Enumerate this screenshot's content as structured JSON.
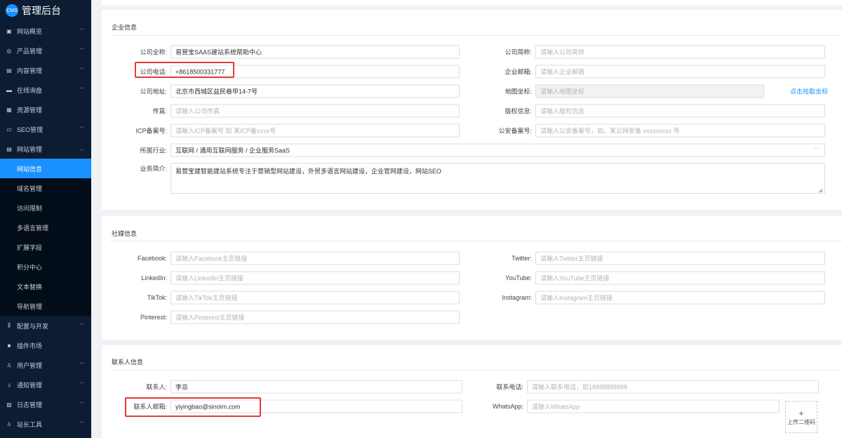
{
  "app": {
    "logo_badge": "CMS",
    "title": "管理后台"
  },
  "sidebar": {
    "items": [
      {
        "label": "网站概览",
        "icon": "monitor-icon",
        "ic": "▣",
        "chev": true
      },
      {
        "label": "产品管理",
        "icon": "cube-icon",
        "ic": "◎",
        "chev": true
      },
      {
        "label": "内容管理",
        "icon": "document-icon",
        "ic": "▤",
        "chev": true
      },
      {
        "label": "在线询盘",
        "icon": "chat-icon",
        "ic": "▬",
        "chev": true
      },
      {
        "label": "资源管理",
        "icon": "folder-icon",
        "ic": "▦",
        "chev": false
      },
      {
        "label": "SEO管理",
        "icon": "seo-icon",
        "ic": "▭",
        "chev": true
      },
      {
        "label": "网站管理",
        "icon": "site-icon",
        "ic": "▤",
        "chev": "up"
      }
    ],
    "subitems": [
      "网站信息",
      "域名管理",
      "访问限制",
      "多语言管理",
      "扩展字段",
      "积分中心",
      "文本替换",
      "导航管理"
    ],
    "active_sub": 0,
    "items2": [
      {
        "label": "配置与开发",
        "icon": "sliders-icon",
        "ic": "⫼",
        "chev": true
      },
      {
        "label": "插件市场",
        "icon": "lock-icon",
        "ic": "■",
        "chev": false
      },
      {
        "label": "用户管理",
        "icon": "user-icon",
        "ic": "♙",
        "chev": true
      },
      {
        "label": "通知管理",
        "icon": "bell-icon",
        "ic": "♫",
        "chev": true
      },
      {
        "label": "日志管理",
        "icon": "log-icon",
        "ic": "▧",
        "chev": true
      },
      {
        "label": "站长工具",
        "icon": "tool-icon",
        "ic": "♙",
        "chev": true
      }
    ]
  },
  "company": {
    "title": "企业信息",
    "full_name": {
      "label": "公司全称:",
      "value": "易营宝SAAS建站系统帮助中心"
    },
    "short_name": {
      "label": "公司简称:",
      "placeholder": "请输入公司简称"
    },
    "phone": {
      "label": "公司电话:",
      "value": "+8618500331777"
    },
    "email": {
      "label": "企业邮箱:",
      "placeholder": "请输入企业邮箱"
    },
    "address": {
      "label": "公司地址:",
      "value": "北京市西城区益民巷甲14-7号"
    },
    "map": {
      "label": "地图坐标:",
      "placeholder": "请输入地图坐标",
      "link": "点击拾取坐标"
    },
    "fax": {
      "label": "传真:",
      "placeholder": "请输入公司传真"
    },
    "copyright": {
      "label": "版权信息:",
      "placeholder": "请输入版权信息"
    },
    "icp": {
      "label": "ICP备案号:",
      "placeholder": "请输入ICP备案号 如 某ICP备xxxx号"
    },
    "police": {
      "label": "公安备案号:",
      "placeholder": "请输入公安备案号，如，某公网安备 xxxxxxxxx 号"
    },
    "industry": {
      "label": "所属行业:",
      "value": "互联网 / 通用互联网服务 / 企业服务SaaS"
    },
    "intro": {
      "label": "业务简介:",
      "value": "易营宝建智能建站系统专注于营销型网站建设，外贸多语言网站建设，企业官网建设，网站SEO"
    }
  },
  "social": {
    "title": "社媒信息",
    "facebook": {
      "label": "Facebook:",
      "placeholder": "请输入Facebook主页链接"
    },
    "twitter": {
      "label": "Twitter:",
      "placeholder": "请输入Twitter主页链接"
    },
    "linkedin": {
      "label": "LinkedIn:",
      "placeholder": "请输入LinkedIn主页链接"
    },
    "youtube": {
      "label": "YouTube:",
      "placeholder": "请输入YouTube主页链接"
    },
    "tiktok": {
      "label": "TikTok:",
      "placeholder": "请输入TikTok主页链接"
    },
    "instagram": {
      "label": "Instagram:",
      "placeholder": "请输入Instagram主页链接"
    },
    "pinterest": {
      "label": "Pinterest:",
      "placeholder": "请输入Pinterest主页链接"
    }
  },
  "contact": {
    "title": "联系人信息",
    "name": {
      "label": "联系人:",
      "value": "李总"
    },
    "phone": {
      "label": "联系电话:",
      "placeholder": "请输入联系电话，如18888888888"
    },
    "email": {
      "label": "联系人邮箱:",
      "value": "yiyingbao@sinoim.com"
    },
    "whatsapp": {
      "label": "WhatsApp:",
      "placeholder": "请输入WhatsApp"
    },
    "upload": {
      "icon": "+",
      "label": "上传二维码"
    }
  },
  "colors": {
    "sidebar": "#0b1c33",
    "accent": "#1890ff",
    "highlight": "#e53935"
  }
}
